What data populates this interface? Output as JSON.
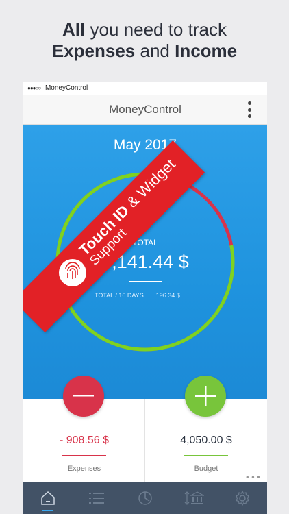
{
  "headline": {
    "line1_bold": "All",
    "line1_rest": "you need to track",
    "line2_bold1": "Expenses",
    "line2_mid": "and",
    "line2_bold2": "Income"
  },
  "statusbar": {
    "signal": "●●●○○",
    "carrier": "MoneyControl"
  },
  "navbar": {
    "title": "MoneyControl",
    "menu_icon": "kebab-menu-icon"
  },
  "main": {
    "month": "May 2017",
    "total_label": "TOTAL",
    "total_value": "3,141.44 $",
    "total_days_label": "TOTAL / 16 DAYS",
    "total_days_value": "196.34 $",
    "ring_progress": 0.78,
    "ring_colors": {
      "used": "#d8334a",
      "remaining": "#7ed321"
    }
  },
  "expenses": {
    "amount": "- 908.56 $",
    "label": "Expenses",
    "color": "#d8334a"
  },
  "budget": {
    "amount": "4,050.00 $",
    "label": "Budget",
    "color": "#78c53b"
  },
  "banner": {
    "line1_bold": "Touch ID",
    "line1_rest": "& Widget",
    "line2": "Support",
    "icon": "fingerprint-icon"
  },
  "tabs": [
    {
      "icon": "home-icon",
      "active": true
    },
    {
      "icon": "list-icon",
      "active": false
    },
    {
      "icon": "history-chart-icon",
      "active": false
    },
    {
      "icon": "bank-transfer-icon",
      "active": false
    },
    {
      "icon": "gear-icon",
      "active": false
    }
  ]
}
